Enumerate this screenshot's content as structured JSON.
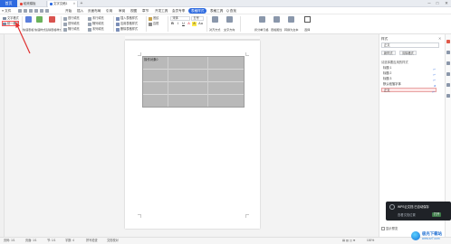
{
  "titlebar": {
    "home": "首页",
    "tabs": [
      {
        "label": "稻壳模板",
        "color": "#e2463b"
      },
      {
        "label": "文字文稿1",
        "color": "#2d6ae0"
      }
    ],
    "plus": "+",
    "win": [
      "─",
      "□",
      "✕"
    ]
  },
  "menubar": {
    "file": "≡ 文件",
    "items": [
      "开始",
      "插入",
      "页面布局",
      "引用",
      "审阅",
      "视图",
      "章节",
      "开发工具",
      "会员专享",
      "表格样式",
      "表格工具"
    ],
    "active": "表格样式",
    "search": "Q 查找"
  },
  "ribbon": {
    "left_small": [
      "文字格式",
      "统一格式"
    ],
    "big": [
      {
        "label": "快速表格",
        "color": "#5b7fdc"
      },
      {
        "label": "快速样式",
        "color": "#6bb25b"
      },
      {
        "label": "清除表格样式",
        "color": "#d9534f"
      }
    ],
    "options": [
      "首行填充",
      "首列填充",
      "隔行填充",
      "末行填充",
      "隔列填充",
      "末列填充"
    ],
    "tools": [
      "插入表格样式",
      "应用表格样式",
      "删除表格样式"
    ],
    "fill": [
      "底纹",
      "边框"
    ],
    "font_name": "宋体",
    "font_size": "五号",
    "fmt": [
      "B",
      "I",
      "U",
      "A",
      "A",
      "Aa"
    ],
    "align": [
      "对齐方式",
      "文字方向"
    ],
    "right": [
      "拆分单元格",
      "表格属性",
      "转换为文本"
    ],
    "select": "选择"
  },
  "page": {
    "table_header": "操作对象0"
  },
  "right_panel": {
    "title": "样式",
    "close": "✕",
    "current": "正文",
    "buttons": [
      "新样式",
      "清除格式"
    ],
    "section_label": "请选择要应用的样式",
    "styles": [
      "标题 1",
      "标题 2",
      "标题 3",
      "默认段落字体",
      "正文"
    ],
    "selected": "正文",
    "show_preview": "显示预览"
  },
  "popup": {
    "line1": "WPS云文档 已自动保存",
    "line2": "查看文档位置",
    "button": "打开"
  },
  "statusbar": {
    "items": [
      "页码: 1/1",
      "页面: 1/1",
      "节: 1/1",
      "字数: 4",
      "拼写检查",
      "文档校对"
    ],
    "zoom": "100%"
  },
  "watermark": {
    "title": "极光下载站",
    "url": "www.xz7.com"
  },
  "colors": {
    "accent": "#2d6ae0",
    "table_fill": "#b9b9b9",
    "arrow": "#e03131"
  }
}
